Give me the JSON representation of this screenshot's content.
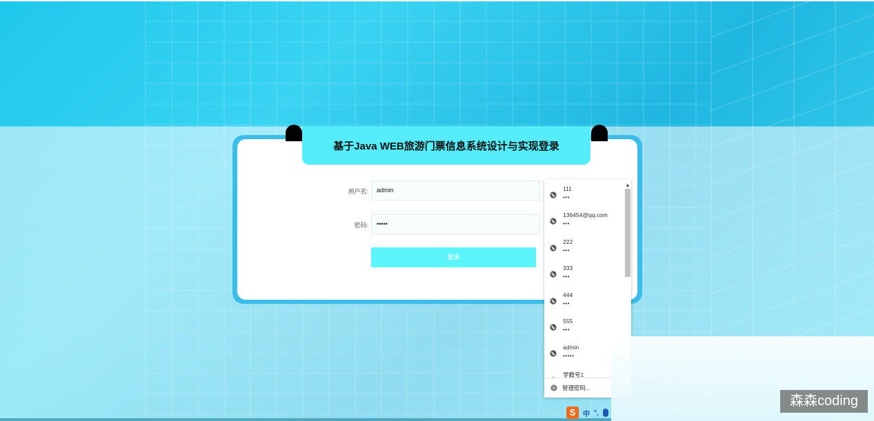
{
  "page": {
    "title": "基于Java WEB旅游门票信息系统设计与实现登录"
  },
  "form": {
    "username_label": "用户名:",
    "username_value": "admin",
    "password_label": "密码:",
    "password_value": "•••••",
    "login_label": "登录"
  },
  "autofill": {
    "entries": [
      {
        "user": "111",
        "pw": "•••"
      },
      {
        "user": "136454@qq.com",
        "pw": "•••"
      },
      {
        "user": "222",
        "pw": "•••"
      },
      {
        "user": "333",
        "pw": "•••"
      },
      {
        "user": "444",
        "pw": "•••"
      },
      {
        "user": "555",
        "pw": "•••"
      },
      {
        "user": "admin",
        "pw": "•••••"
      },
      {
        "user": "学籍号1",
        "pw": ""
      }
    ],
    "manage_label": "管理密码..."
  },
  "ime": {
    "logo": "S",
    "mode": "中",
    "punct": "°,"
  },
  "watermark": "森森coding",
  "colors": {
    "banner": "#55edfb",
    "card_border": "#3cbce8",
    "login_button": "#5bf5fb"
  }
}
